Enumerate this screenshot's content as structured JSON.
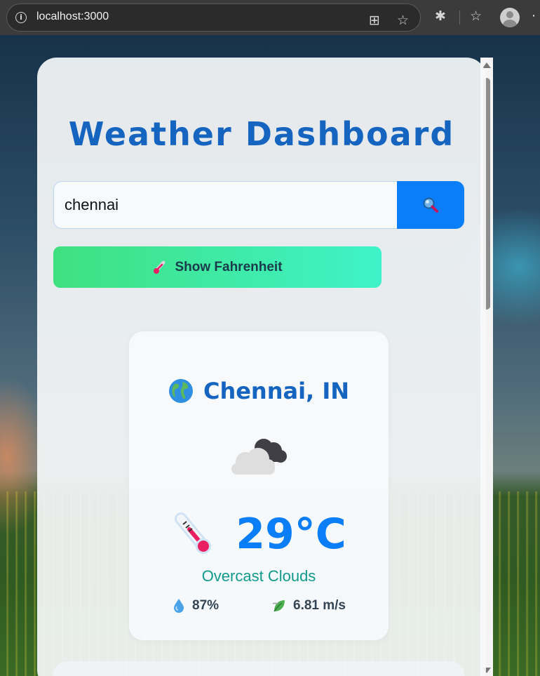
{
  "browser": {
    "url": "localhost:3000"
  },
  "app": {
    "title": "Weather Dashboard"
  },
  "search": {
    "value": "chennai",
    "placeholder": ""
  },
  "toggle": {
    "label": "Show Fahrenheit",
    "icon": "thermometer-icon"
  },
  "weather": {
    "location": "Chennai, IN",
    "condition_icon": "cloud-icon",
    "temperature": "29°C",
    "description": "Overcast Clouds",
    "humidity": "87%",
    "wind": "6.81 m/s"
  },
  "colors": {
    "accent": "#1565c0",
    "button": "#0a7ef8",
    "toggle_start": "#3fe07f",
    "toggle_end": "#3ff3c9",
    "description": "#119a8c"
  }
}
